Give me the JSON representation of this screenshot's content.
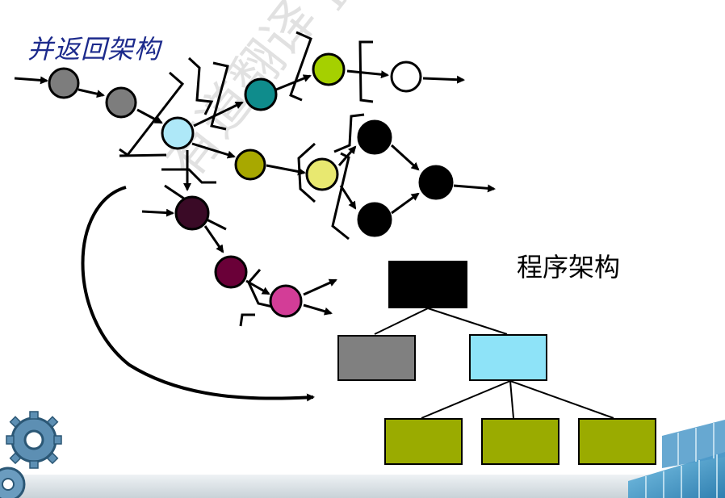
{
  "title": "并返回架构",
  "program_label": "程序架构",
  "watermark": "有道翻译 pdf.youdao.com",
  "colors": {
    "title": "#1c2a8c",
    "node_gray": "#7d7d7d",
    "node_lightblue": "#aee8f8",
    "node_teal": "#0f8c8c",
    "node_lime": "#a5d000",
    "node_olive": "#a8a800",
    "node_yellow": "#e8e870",
    "node_black": "#000000",
    "node_darkpurple": "#3a0a26",
    "node_purple": "#6a0038",
    "node_magenta": "#d33d97",
    "box_black": "#000000",
    "box_gray": "#808080",
    "box_lightblue": "#8ee3f8",
    "box_olive": "#9aab00"
  },
  "icons": [
    "gear-icon",
    "building-glass-icon"
  ]
}
